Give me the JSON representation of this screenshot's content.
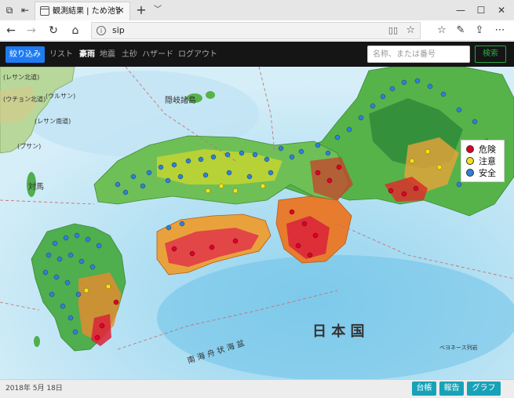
{
  "browser": {
    "tab_title": "観測結果 | ため池管理",
    "address": "sip",
    "icons": [
      "window-icon",
      "tab-icon",
      "back-arrow-icon",
      "forward-arrow-icon",
      "refresh-icon",
      "home-icon",
      "info-icon",
      "reading-view-icon",
      "favorite-star-icon",
      "favorites-icon",
      "pen-icon",
      "share-icon",
      "more-icon"
    ]
  },
  "app": {
    "filter_button": "絞り込み",
    "menu": [
      "リスト",
      "豪雨",
      "地震",
      "土砂",
      "ハザード",
      "ログアウト"
    ],
    "active_menu": "豪雨",
    "search": {
      "placeholder": "名称、または番号",
      "button": "検索"
    }
  },
  "map": {
    "labels": {
      "korea": "(レサン北道)",
      "korea2": "(ウチョン北道)",
      "korea3": "(レサン南道)",
      "busan": "(プサン)",
      "ulsan": "(ウルサン)",
      "oki": "隠岐諸島",
      "tsushima": "対馬",
      "sea": "日 本 国",
      "shikoku_sea": "南 海 舟 状 海 盆",
      "trough": "ベヨネース列岩"
    },
    "legend": [
      {
        "label": "危険",
        "color": "#e0002a"
      },
      {
        "label": "注意",
        "color": "#f2e21c"
      },
      {
        "label": "安全",
        "color": "#2f80d6"
      }
    ]
  },
  "footer": {
    "date": "2018年 5月 18日",
    "buttons": [
      "台帳",
      "報告",
      "グラフ"
    ]
  },
  "colors": {
    "accent_blue": "#1e7bf2",
    "teal": "#17a2b8",
    "green": "#28a745",
    "header_dark": "#151515"
  }
}
